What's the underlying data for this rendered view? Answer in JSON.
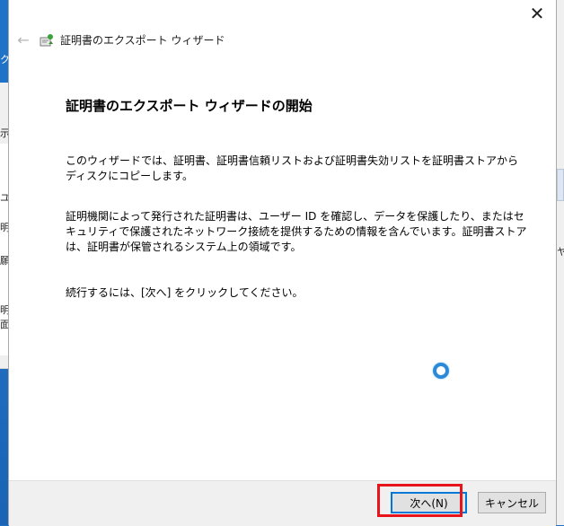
{
  "dialog": {
    "title": "証明書のエクスポート ウィザード",
    "heading": "証明書のエクスポート ウィザードの開始",
    "paragraph1": "このウィザードでは、証明書、証明書信頼リストおよび証明書失効リストを証明書ストアからディスクにコピーします。",
    "paragraph2": "証明機関によって発行された証明書は、ユーザー ID を確認し、データを保護したり、またはセキュリティで保護されたネットワーク接続を提供するための情報を含んでいます。証明書ストアは、証明書が保管されるシステム上の領域です。",
    "paragraph3": "続行するには、[次へ] をクリックしてください。",
    "close_icon": "close-icon",
    "back_icon": "back-arrow-icon",
    "cert_icon": "certificate-icon"
  },
  "buttons": {
    "next_label": "次へ(N)",
    "cancel_label": "キャンセル"
  },
  "background": {
    "left_fragments": [
      "ク",
      "示",
      "ユー",
      "明",
      "願",
      "明",
      "面"
    ],
    "right_fragments": [
      "ヤ"
    ]
  },
  "colors": {
    "highlight": "#e8141b",
    "accent": "#0078d7",
    "desktop": "#1e73c8"
  }
}
